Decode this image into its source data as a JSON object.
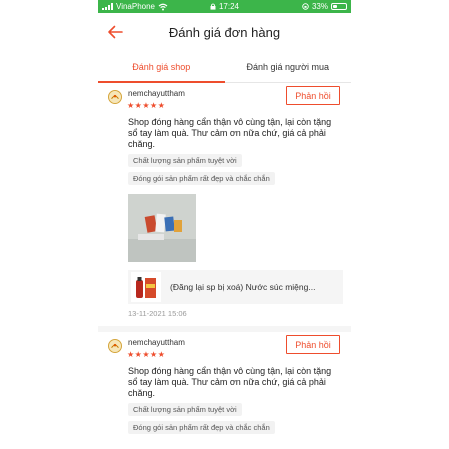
{
  "statusbar": {
    "carrier": "VinaPhone",
    "time": "17:24",
    "battery": "33%",
    "battery_level": 0.33
  },
  "header": {
    "title": "Đánh giá đơn hàng"
  },
  "tabs": [
    {
      "label": "Đánh giá shop",
      "active": true
    },
    {
      "label": "Đánh giá người mua",
      "active": false
    }
  ],
  "reviews": [
    {
      "username": "nemchayuttham",
      "stars": "★★★★★",
      "reply_label": "Phản hồi",
      "text": "Shop đóng hàng cẩn thận vô cùng tận, lại còn tặng sổ tay làm quà. Thư cảm ơn nữa chứ, giá cả phải chăng.",
      "tags": [
        "Chất lượng sản phẩm tuyệt vời",
        "Đóng gói sản phẩm rất đẹp và chắc chắn"
      ],
      "product_name": "(Đăng lại sp bị xoá) Nước súc miệng...",
      "date": "13-11-2021 15:06"
    },
    {
      "username": "nemchayuttham",
      "stars": "★★★★★",
      "reply_label": "Phản hồi",
      "text": "Shop đóng hàng cẩn thận vô cùng tận, lại còn tặng sổ tay làm quà. Thư cảm ơn nữa chứ, giá cả phải chăng.",
      "tags": [
        "Chất lượng sản phẩm tuyệt vời",
        "Đóng gói sản phẩm rất đẹp và chắc chắn"
      ]
    }
  ],
  "colors": {
    "accent": "#ee4d2d",
    "statusbar": "#3cb54a"
  }
}
